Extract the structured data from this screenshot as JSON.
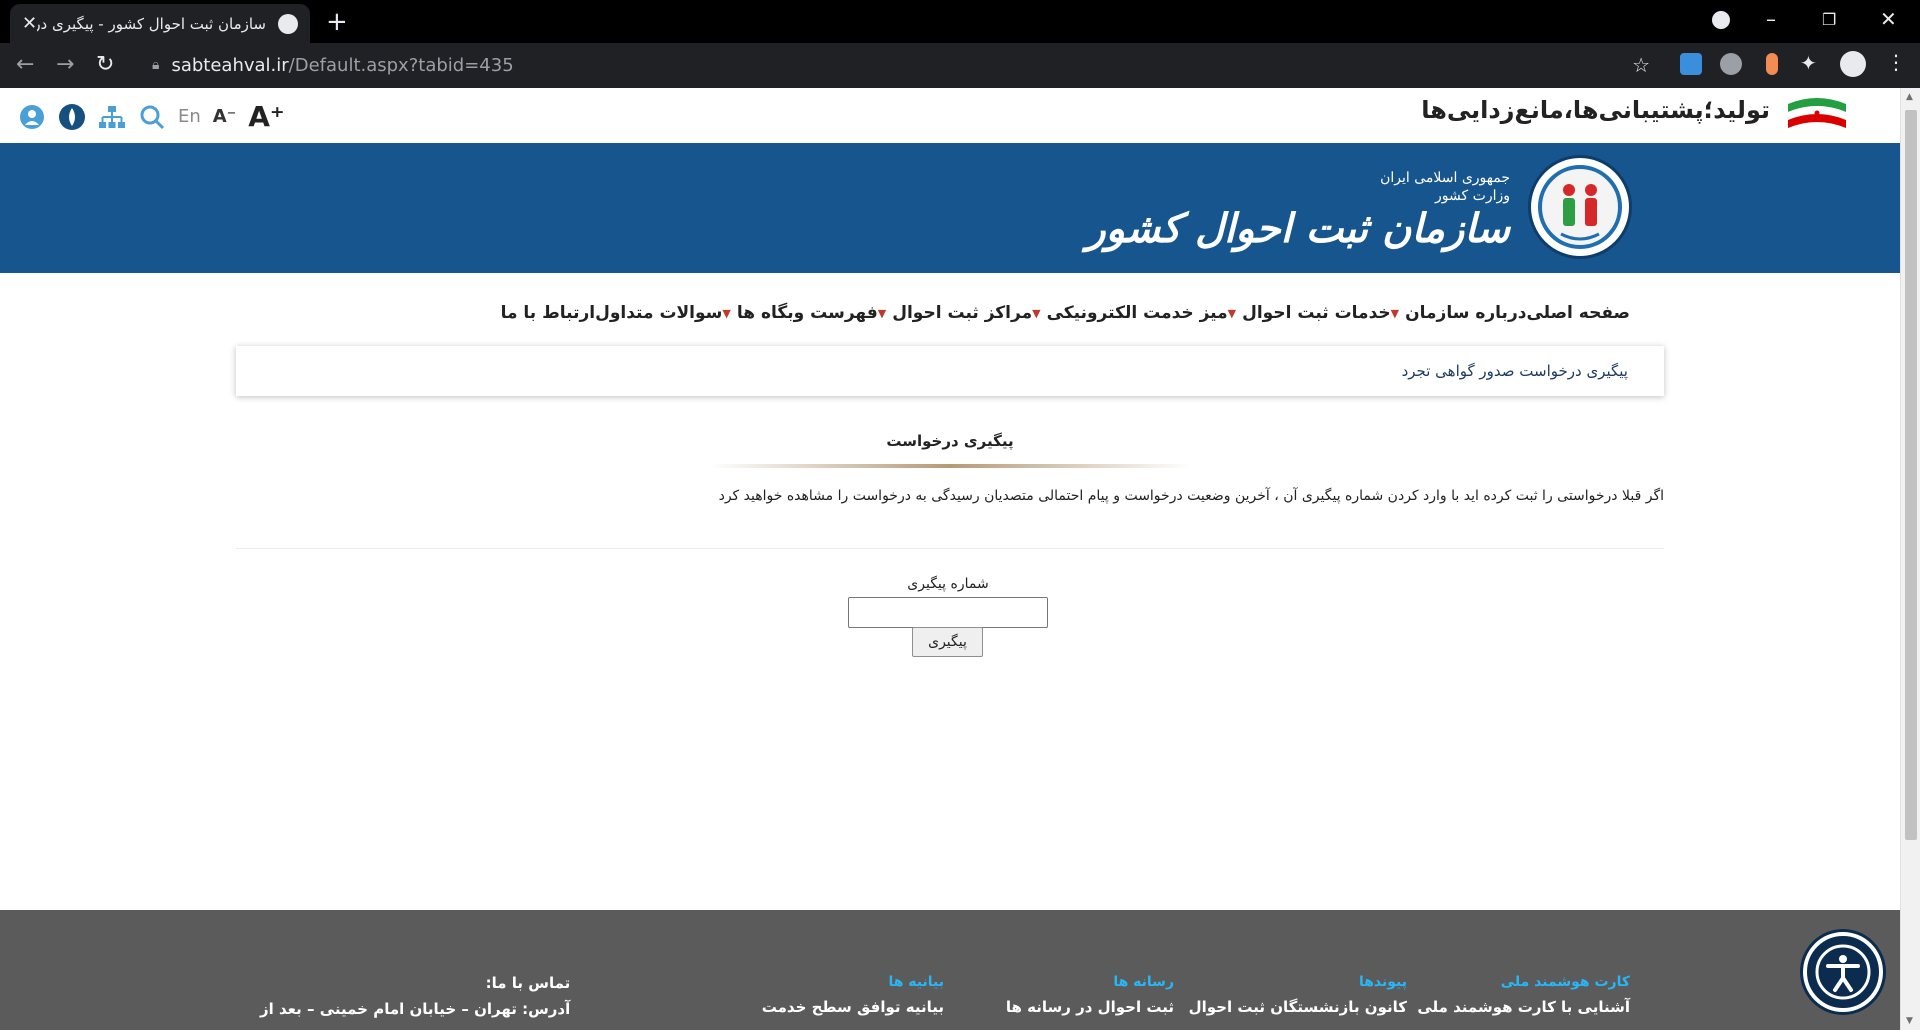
{
  "browser": {
    "tab_title": "سازمان ثبت احوال کشور - پیگیری در",
    "url_host": "sabteahval.ir",
    "url_path": "/Default.aspx?tabid=435"
  },
  "header": {
    "slogan": "تولید؛پشتیبانی‌ها،مانع‌زدایی‌ها",
    "lang_label": "En",
    "font_smaller": "A⁻",
    "font_larger": "A⁺",
    "logo_line1": "جمهوری اسلامی ایران",
    "logo_line2": "وزارت کشور",
    "logo_main": "سازمان ثبت احوال کشور",
    "banner_color": "#17558f"
  },
  "nav": {
    "items": [
      {
        "label": "صفحه اصلی",
        "dropdown": false
      },
      {
        "label": "درباره سازمان",
        "dropdown": true
      },
      {
        "label": "خدمات ثبت احوال",
        "dropdown": true
      },
      {
        "label": "میز خدمت الکترونیکی",
        "dropdown": true
      },
      {
        "label": "مراکز ثبت احوال",
        "dropdown": true
      },
      {
        "label": "فهرست وبگاه ها",
        "dropdown": true
      },
      {
        "label": "سوالات متداول",
        "dropdown": false
      },
      {
        "label": "ارتباط با ما",
        "dropdown": false
      }
    ]
  },
  "breadcrumb": "پیگیری درخواست صدور گواهی تجرد",
  "main": {
    "section_title": "پیگیری درخواست",
    "intro": "اگر قبلا درخواستی را ثبت کرده اید با وارد کردن شماره پیگیری آن ، آخرین وضعیت درخواست و پیام احتمالی متصدیان رسیدگی به درخواست را مشاهده خواهید کرد",
    "tracking_label": "شماره پیگیری",
    "tracking_value": "",
    "submit_label": "پیگیری"
  },
  "footer": {
    "columns": [
      {
        "heading": "کارت هوشمند ملی",
        "link": "آشنایی با کارت هوشمند ملی"
      },
      {
        "heading": "پیوندها",
        "link": "کانون بازنشستگان ثبت احوال"
      },
      {
        "heading": "رسانه ها",
        "link": "ثبت احوال در رسانه ها"
      },
      {
        "heading": "بیانیه ها",
        "link": "بیانیه توافق سطح خدمت"
      }
    ],
    "contact_heading": "تماس با ما:",
    "contact_address": "آدرس: تهران – خیابان امام خمینی – بعد از"
  }
}
